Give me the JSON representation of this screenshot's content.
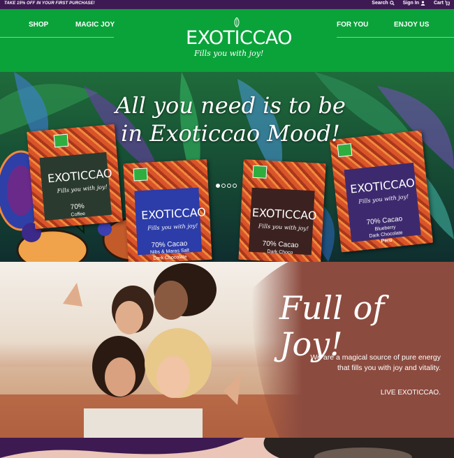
{
  "promo": {
    "text": "TAKE 15% OFF IN YOUR FIRST PURCHASE!",
    "search_label": "Search",
    "signin_label": "Sign In",
    "cart_label": "Cart"
  },
  "nav": {
    "left": [
      "SHOP",
      "MAGIC JOY"
    ],
    "right": [
      "FOR YOU",
      "ENJOY US"
    ]
  },
  "logo": {
    "word": "EXOTICCAO",
    "tagline": "Fills you with joy!"
  },
  "hero": {
    "title_line1": "All you need is to be",
    "title_line2": "in Exoticcao Mood!",
    "slide_count": 4,
    "active_slide": 1,
    "packs": [
      {
        "brand": "EXOTICCAO",
        "tagline": "Fills you with joy!",
        "cacao": "70%",
        "sub": "Coffee"
      },
      {
        "brand": "EXOTICCAO",
        "tagline": "Fills you with joy!",
        "cacao": "70% Cacao",
        "sub": "Nibs & Maras Salt",
        "sub2": "Dark Chocolate"
      },
      {
        "brand": "EXOTICCAO",
        "tagline": "Fills you with joy!",
        "cacao": "70% Cacao",
        "sub": "Dark Choco"
      },
      {
        "brand": "EXOTICCAO",
        "tagline": "Fills you with joy!",
        "cacao": "70% Cacao",
        "sub": "Blueberry",
        "sub2": "Dark Chocolate",
        "sub3": "Peru"
      }
    ]
  },
  "joy": {
    "title": "Full of Joy!",
    "text_line1": "We are a magical source of pure energy",
    "text_line2": "that fills you with joy and vitality.",
    "cta": "LIVE EXOTICCAO."
  },
  "colors": {
    "promo_bg": "#3d1a52",
    "header_bg": "#0aa33a",
    "joy_brown": "#8c4b3f",
    "bottom_pink": "#ebc6b8"
  }
}
